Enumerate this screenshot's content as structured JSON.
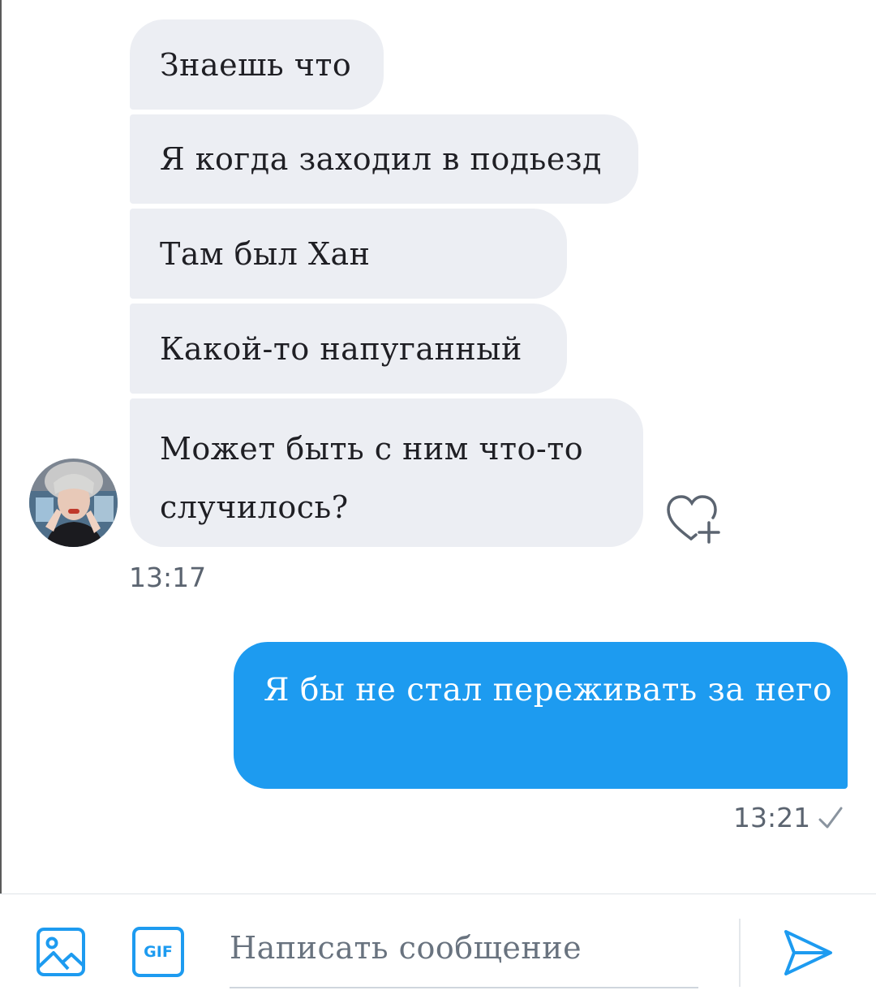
{
  "conversation": {
    "incoming": [
      {
        "text": "Знаешь что"
      },
      {
        "text": "Я когда заходил в подьезд"
      },
      {
        "text": "Там был Хан"
      },
      {
        "text": "Какой-то напуганный"
      },
      {
        "text": "Может быть с ним что-то случилось?"
      }
    ],
    "incoming_time": "13:17",
    "outgoing": {
      "text": "Я бы не стал переживать за него"
    },
    "outgoing_time": "13:21"
  },
  "composer": {
    "placeholder": "Написать сообщение",
    "gif_label": "GIF"
  },
  "icons": {
    "image": "image-icon",
    "gif": "gif-icon",
    "send": "send-icon",
    "react": "heart-plus-icon",
    "read": "checkmark-icon"
  },
  "colors": {
    "accent": "#1d9bf0",
    "incoming_bubble": "#eceef3",
    "text": "#1f1f24",
    "muted": "#5b6470"
  }
}
